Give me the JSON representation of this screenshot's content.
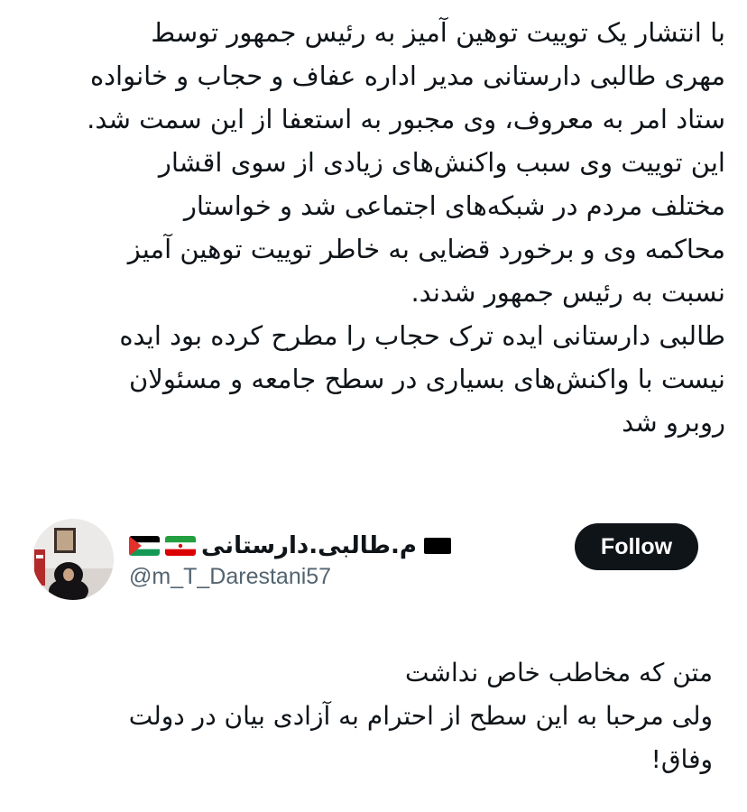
{
  "news": {
    "lines": [
      "با انتشار یک توییت توهین آمیز به رئیس جمهور توسط",
      "مهری طالبی دارستانی مدیر اداره عفاف و حجاب و خانواده",
      "ستاد امر به معروف، وی مجبور به استعفا از این سمت شد.",
      "این توییت وی سبب واکنش‌های زیادی از سوی اقشار",
      "مختلف مردم در شبکه‌های اجتماعی شد و خواستار",
      "محاکمه وی و برخورد قضایی به خاطر توییت توهین آمیز",
      "نسبت به رئیس جمهور شدند.",
      "طالبی دارستانی ایده ترک حجاب را مطرح کرده بود ایده",
      "نیست با واکنش‌های بسیاری در سطح جامعه و مسئولان",
      "روبرو شد"
    ]
  },
  "quoted_tweet": {
    "follow_label": "Follow",
    "display_name": "م.طالبی.دارستانی",
    "handle": "@m_T_Darestani57",
    "flags": [
      "palestine-flag",
      "iran-flag",
      "black-flag"
    ],
    "text_lines": [
      "متن که مخاطب خاص نداشت",
      "ولی مرحبا به این سطح از احترام به آزادی بیان در دولت",
      "وفاق!"
    ]
  },
  "colors": {
    "text": "#0f1419",
    "muted": "#536471",
    "button_bg": "#0f1419",
    "button_text": "#ffffff"
  }
}
